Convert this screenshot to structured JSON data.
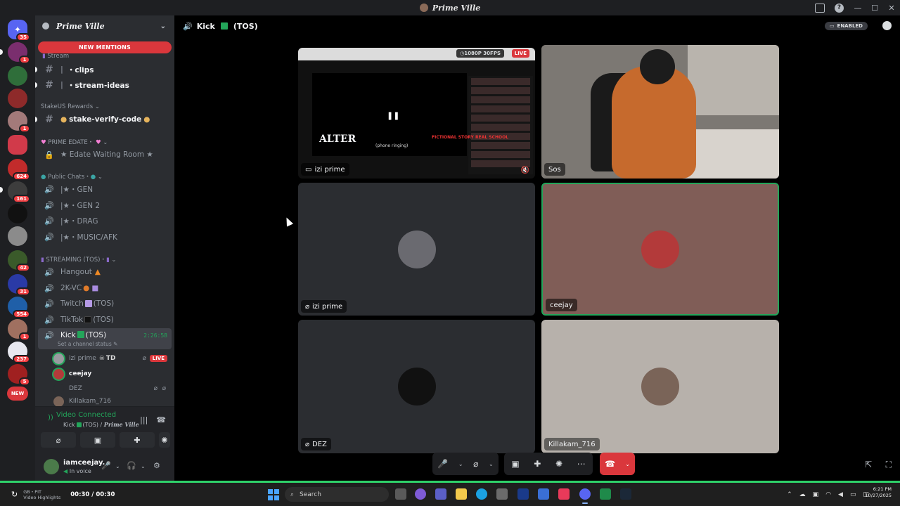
{
  "window": {
    "title": "Prime Ville"
  },
  "guild": {
    "name": "Prime Ville"
  },
  "server_badges": [
    "35",
    "1",
    "1",
    "624",
    "161",
    "42",
    "31",
    "554",
    "1",
    "237",
    "5"
  ],
  "server_new": "NEW",
  "new_mentions": "NEW MENTIONS",
  "sidebar": {
    "stream_cat": "Stream",
    "clips": "・clips",
    "stream_ideas": "・stream-ideas",
    "stakeus_cat": "StakeUS Rewards",
    "stake_verify": "stake-verify-code",
    "prime_edate_cat": "PRIME EDATE・",
    "edate_waiting": "★ Edate Waiting Room ★",
    "public_chats_cat": "Public Chats・",
    "gen": "|★・GEN",
    "gen2": "|★・GEN 2",
    "drag": "|★・DRAG",
    "music": "|★・MUSIC/AFK",
    "streaming_cat": "STREAMING (TOS)・",
    "hangout": "Hangout",
    "twok": "2K-VC",
    "twitch": "Twitch",
    "twitch_tos": "(TOS)",
    "tiktok": "TikTok",
    "tiktok_tos": "(TOS)",
    "kick": "Kick",
    "kick_tos": "(TOS)",
    "kick_timer": "2:26:58",
    "kick_status": "Set a channel status"
  },
  "voice_users": [
    {
      "name": "izi prime",
      "tag": "TD",
      "live": "LIVE"
    },
    {
      "name": "ceejay"
    },
    {
      "name": "DEZ"
    },
    {
      "name": "Killakam_716"
    }
  ],
  "voice_panel": {
    "status": "Video Connected",
    "channel": "Kick",
    "channel_tos": "(TOS) /",
    "guild": "Prime Ville"
  },
  "user": {
    "name": "iamceejay.",
    "status": "In voice"
  },
  "header": {
    "channel": "Kick",
    "tos": "(TOS)",
    "enabled": "ENABLED"
  },
  "tiles": [
    {
      "name": "izi prime",
      "quality": "1080P 30FPS",
      "live": "LIVE",
      "screen_title": "ALTER",
      "screen_caption": "(phone ringing)",
      "screen_side": "FICTIONAL STORY REAL SCHOOL"
    },
    {
      "name": "Sos"
    },
    {
      "name": "izi prime"
    },
    {
      "name": "ceejay"
    },
    {
      "name": "DEZ"
    },
    {
      "name": "Killakam_716"
    }
  ],
  "colors": {
    "accent_green": "#23a55a",
    "danger": "#da373c",
    "tile_ceejay": "#805d57",
    "tile_killakam": "#b7b1ab"
  },
  "taskbar": {
    "media_line1": "GB・PIT",
    "media_line2": "Video Highlights",
    "media_time": "00:30 / 00:30",
    "search_placeholder": "Search",
    "clock_time": "6:21 PM",
    "clock_date": "10/27/2025"
  }
}
